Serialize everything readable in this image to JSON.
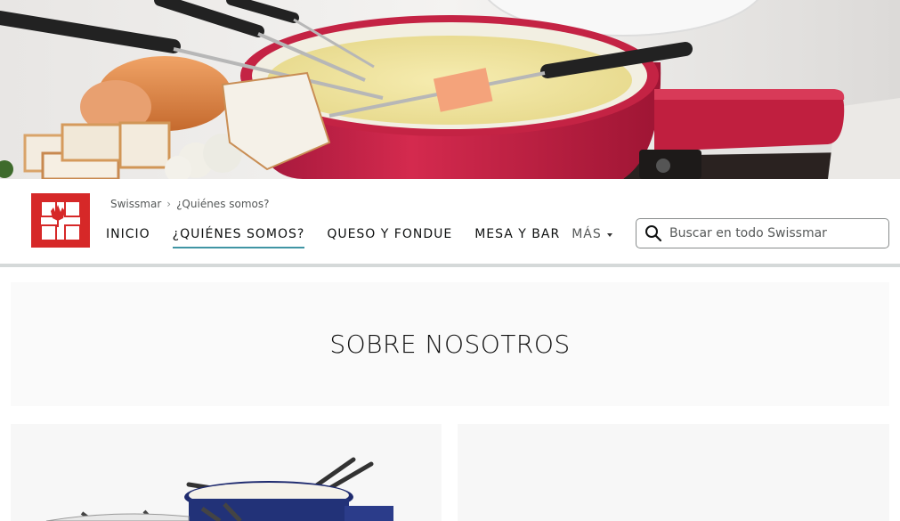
{
  "hero": {
    "image_alt": "fondue-pot-with-bread-and-forks"
  },
  "header": {
    "logo_icon": "canadian-swiss-cross-logo",
    "breadcrumb": [
      "Swissmar",
      "¿Quiénes somos?"
    ],
    "nav": [
      {
        "label": "INICIO",
        "active": false
      },
      {
        "label": "¿QUIÉNES SOMOS?",
        "active": true
      },
      {
        "label": "QUESO Y FONDUE",
        "active": false
      },
      {
        "label": "MESA Y BAR",
        "active": false
      }
    ],
    "more_label": "MÁS",
    "search": {
      "placeholder": "Buscar en todo Swissmar"
    }
  },
  "main": {
    "about_title": "SOBRE NOSOTROS"
  },
  "colors": {
    "logo_red": "#d62828",
    "pot_red": "#c01f3f",
    "active_underline": "#007185",
    "divider": "#d5d9d9"
  }
}
